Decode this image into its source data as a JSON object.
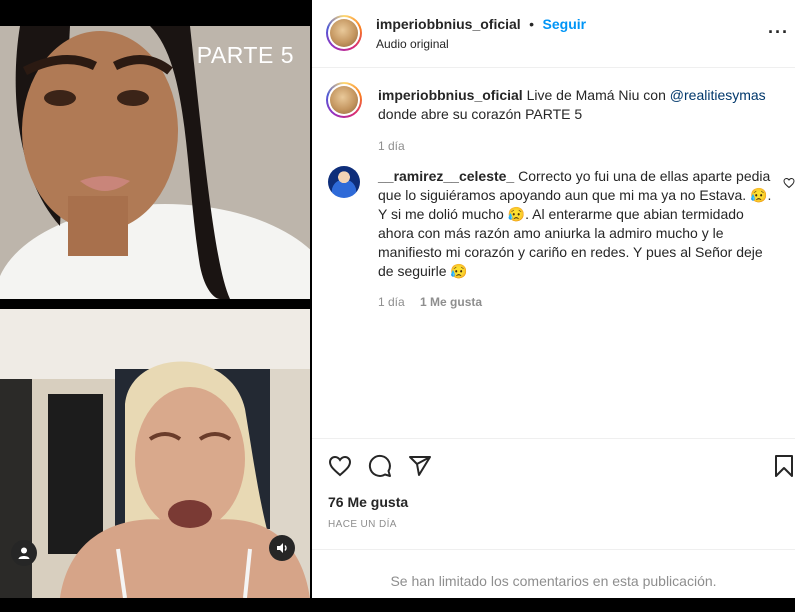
{
  "media": {
    "top_label": "PARTE 5",
    "user_icon": "person-icon",
    "sound_icon": "speaker-icon"
  },
  "header": {
    "username": "imperiobbnius_oficial",
    "separator": "•",
    "follow_label": "Seguir",
    "audio": "Audio original",
    "more_icon": "more-options-icon",
    "more_glyph": "···"
  },
  "caption": {
    "username": "imperiobbnius_oficial",
    "text_before": " Live de Mamá Niu con ",
    "mention": "@realitiesymas",
    "text_after": " donde abre su corazón PARTE 5",
    "time": "1 día"
  },
  "comment": {
    "username": "__ramirez__celeste_",
    "text_1": " Correcto yo fui una de ellas aparte pedia que lo siguiéramos apoyando aun que mi ma ya no Estava. ",
    "emoji_1": "😥",
    "text_2": ". Y si me dolió mucho ",
    "emoji_2": "😥",
    "text_3": ". Al enterarme que abian termidado ahora con más razón amo aniurka la admiro mucho y le manifiesto mi corazón y cariño en redes. Y pues al Señor deje de seguirle ",
    "emoji_3": "😥",
    "time": "1 día",
    "likes": "1 Me gusta"
  },
  "actions": {
    "like_icon": "heart-icon",
    "comment_icon": "comment-icon",
    "share_icon": "share-icon",
    "save_icon": "bookmark-icon",
    "likes_count": "76 Me gusta",
    "date": "HACE UN DÍA",
    "limited_notice": "Se han limitado los comentarios en esta publicación."
  },
  "colors": {
    "accent": "#0095f6",
    "muted": "#8e8e8e",
    "text": "#262626"
  }
}
